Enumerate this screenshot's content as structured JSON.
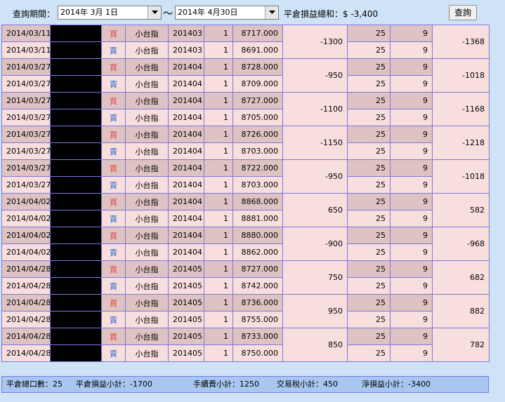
{
  "query": {
    "period_label": "查詢期間：",
    "start_date": "2014年  3月  1日",
    "end_date": "2014年  4月30日",
    "tilde": "～",
    "total_label": "平倉損益總和：$ -3,400",
    "query_button": "查詢"
  },
  "trades": [
    {
      "rows": [
        {
          "date": "2014/03/11",
          "side": "買",
          "product": "小台指",
          "month": "201403",
          "qty": "1",
          "price": "8717.000",
          "fee": "25",
          "tax": "9"
        },
        {
          "date": "2014/03/11",
          "side": "賣",
          "product": "小台指",
          "month": "201403",
          "qty": "1",
          "price": "8691.000",
          "fee": "25",
          "tax": "9"
        }
      ],
      "pl": "-1300",
      "net": "-1368"
    },
    {
      "rows": [
        {
          "date": "2014/03/27",
          "side": "買",
          "product": "小台指",
          "month": "201404",
          "qty": "1",
          "price": "8728.000",
          "fee": "25",
          "tax": "9"
        },
        {
          "date": "2014/03/27",
          "side": "賣",
          "product": "小台指",
          "month": "201404",
          "qty": "1",
          "price": "8709.000",
          "fee": "25",
          "tax": "9"
        }
      ],
      "pl": "-950",
      "net": "-1018"
    },
    {
      "rows": [
        {
          "date": "2014/03/27",
          "side": "買",
          "product": "小台指",
          "month": "201404",
          "qty": "1",
          "price": "8727.000",
          "fee": "25",
          "tax": "9"
        },
        {
          "date": "2014/03/27",
          "side": "賣",
          "product": "小台指",
          "month": "201404",
          "qty": "1",
          "price": "8705.000",
          "fee": "25",
          "tax": "9"
        }
      ],
      "pl": "-1100",
      "net": "-1168"
    },
    {
      "rows": [
        {
          "date": "2014/03/27",
          "side": "買",
          "product": "小台指",
          "month": "201404",
          "qty": "1",
          "price": "8726.000",
          "fee": "25",
          "tax": "9"
        },
        {
          "date": "2014/03/27",
          "side": "賣",
          "product": "小台指",
          "month": "201404",
          "qty": "1",
          "price": "8703.000",
          "fee": "25",
          "tax": "9"
        }
      ],
      "pl": "-1150",
      "net": "-1218"
    },
    {
      "rows": [
        {
          "date": "2014/03/27",
          "side": "買",
          "product": "小台指",
          "month": "201404",
          "qty": "1",
          "price": "8722.000",
          "fee": "25",
          "tax": "9"
        },
        {
          "date": "2014/03/27",
          "side": "賣",
          "product": "小台指",
          "month": "201404",
          "qty": "1",
          "price": "8703.000",
          "fee": "25",
          "tax": "9"
        }
      ],
      "pl": "-950",
      "net": "-1018"
    },
    {
      "rows": [
        {
          "date": "2014/04/02",
          "side": "買",
          "product": "小台指",
          "month": "201404",
          "qty": "1",
          "price": "8868.000",
          "fee": "25",
          "tax": "9"
        },
        {
          "date": "2014/04/02",
          "side": "賣",
          "product": "小台指",
          "month": "201404",
          "qty": "1",
          "price": "8881.000",
          "fee": "25",
          "tax": "9"
        }
      ],
      "pl": "650",
      "net": "582"
    },
    {
      "rows": [
        {
          "date": "2014/04/02",
          "side": "買",
          "product": "小台指",
          "month": "201404",
          "qty": "1",
          "price": "8880.000",
          "fee": "25",
          "tax": "9"
        },
        {
          "date": "2014/04/02",
          "side": "賣",
          "product": "小台指",
          "month": "201404",
          "qty": "1",
          "price": "8862.000",
          "fee": "25",
          "tax": "9"
        }
      ],
      "pl": "-900",
      "net": "-968"
    },
    {
      "rows": [
        {
          "date": "2014/04/28",
          "side": "買",
          "product": "小台指",
          "month": "201405",
          "qty": "1",
          "price": "8727.000",
          "fee": "25",
          "tax": "9"
        },
        {
          "date": "2014/04/28",
          "side": "賣",
          "product": "小台指",
          "month": "201405",
          "qty": "1",
          "price": "8742.000",
          "fee": "25",
          "tax": "9"
        }
      ],
      "pl": "750",
      "net": "682"
    },
    {
      "rows": [
        {
          "date": "2014/04/28",
          "side": "買",
          "product": "小台指",
          "month": "201405",
          "qty": "1",
          "price": "8736.000",
          "fee": "25",
          "tax": "9"
        },
        {
          "date": "2014/04/28",
          "side": "賣",
          "product": "小台指",
          "month": "201405",
          "qty": "1",
          "price": "8755.000",
          "fee": "25",
          "tax": "9"
        }
      ],
      "pl": "950",
      "net": "882"
    },
    {
      "rows": [
        {
          "date": "2014/04/28",
          "side": "買",
          "product": "小台指",
          "month": "201405",
          "qty": "1",
          "price": "8733.000",
          "fee": "25",
          "tax": "9"
        },
        {
          "date": "2014/04/28",
          "side": "賣",
          "product": "小台指",
          "month": "201405",
          "qty": "1",
          "price": "8750.000",
          "fee": "25",
          "tax": "9"
        }
      ],
      "pl": "850",
      "net": "782"
    }
  ],
  "footer": {
    "total_lots": "平倉總口數：25",
    "pl_subtotal": "平倉損益小計：-1700",
    "fee_subtotal": "手續費小計：1250",
    "tax_subtotal": "交易稅小計：450",
    "net_subtotal": "淨損益小計：-3400"
  },
  "colors": {
    "background": "#cfe3f7",
    "row_dark": "#dfc3c3",
    "row_light": "#f9dede",
    "border": "#7b78e0",
    "buy": "#e04040",
    "sell": "#2a6fc8",
    "footer": "#a7c6f0"
  },
  "icons": {
    "dropdown": "chevron-down-icon"
  }
}
